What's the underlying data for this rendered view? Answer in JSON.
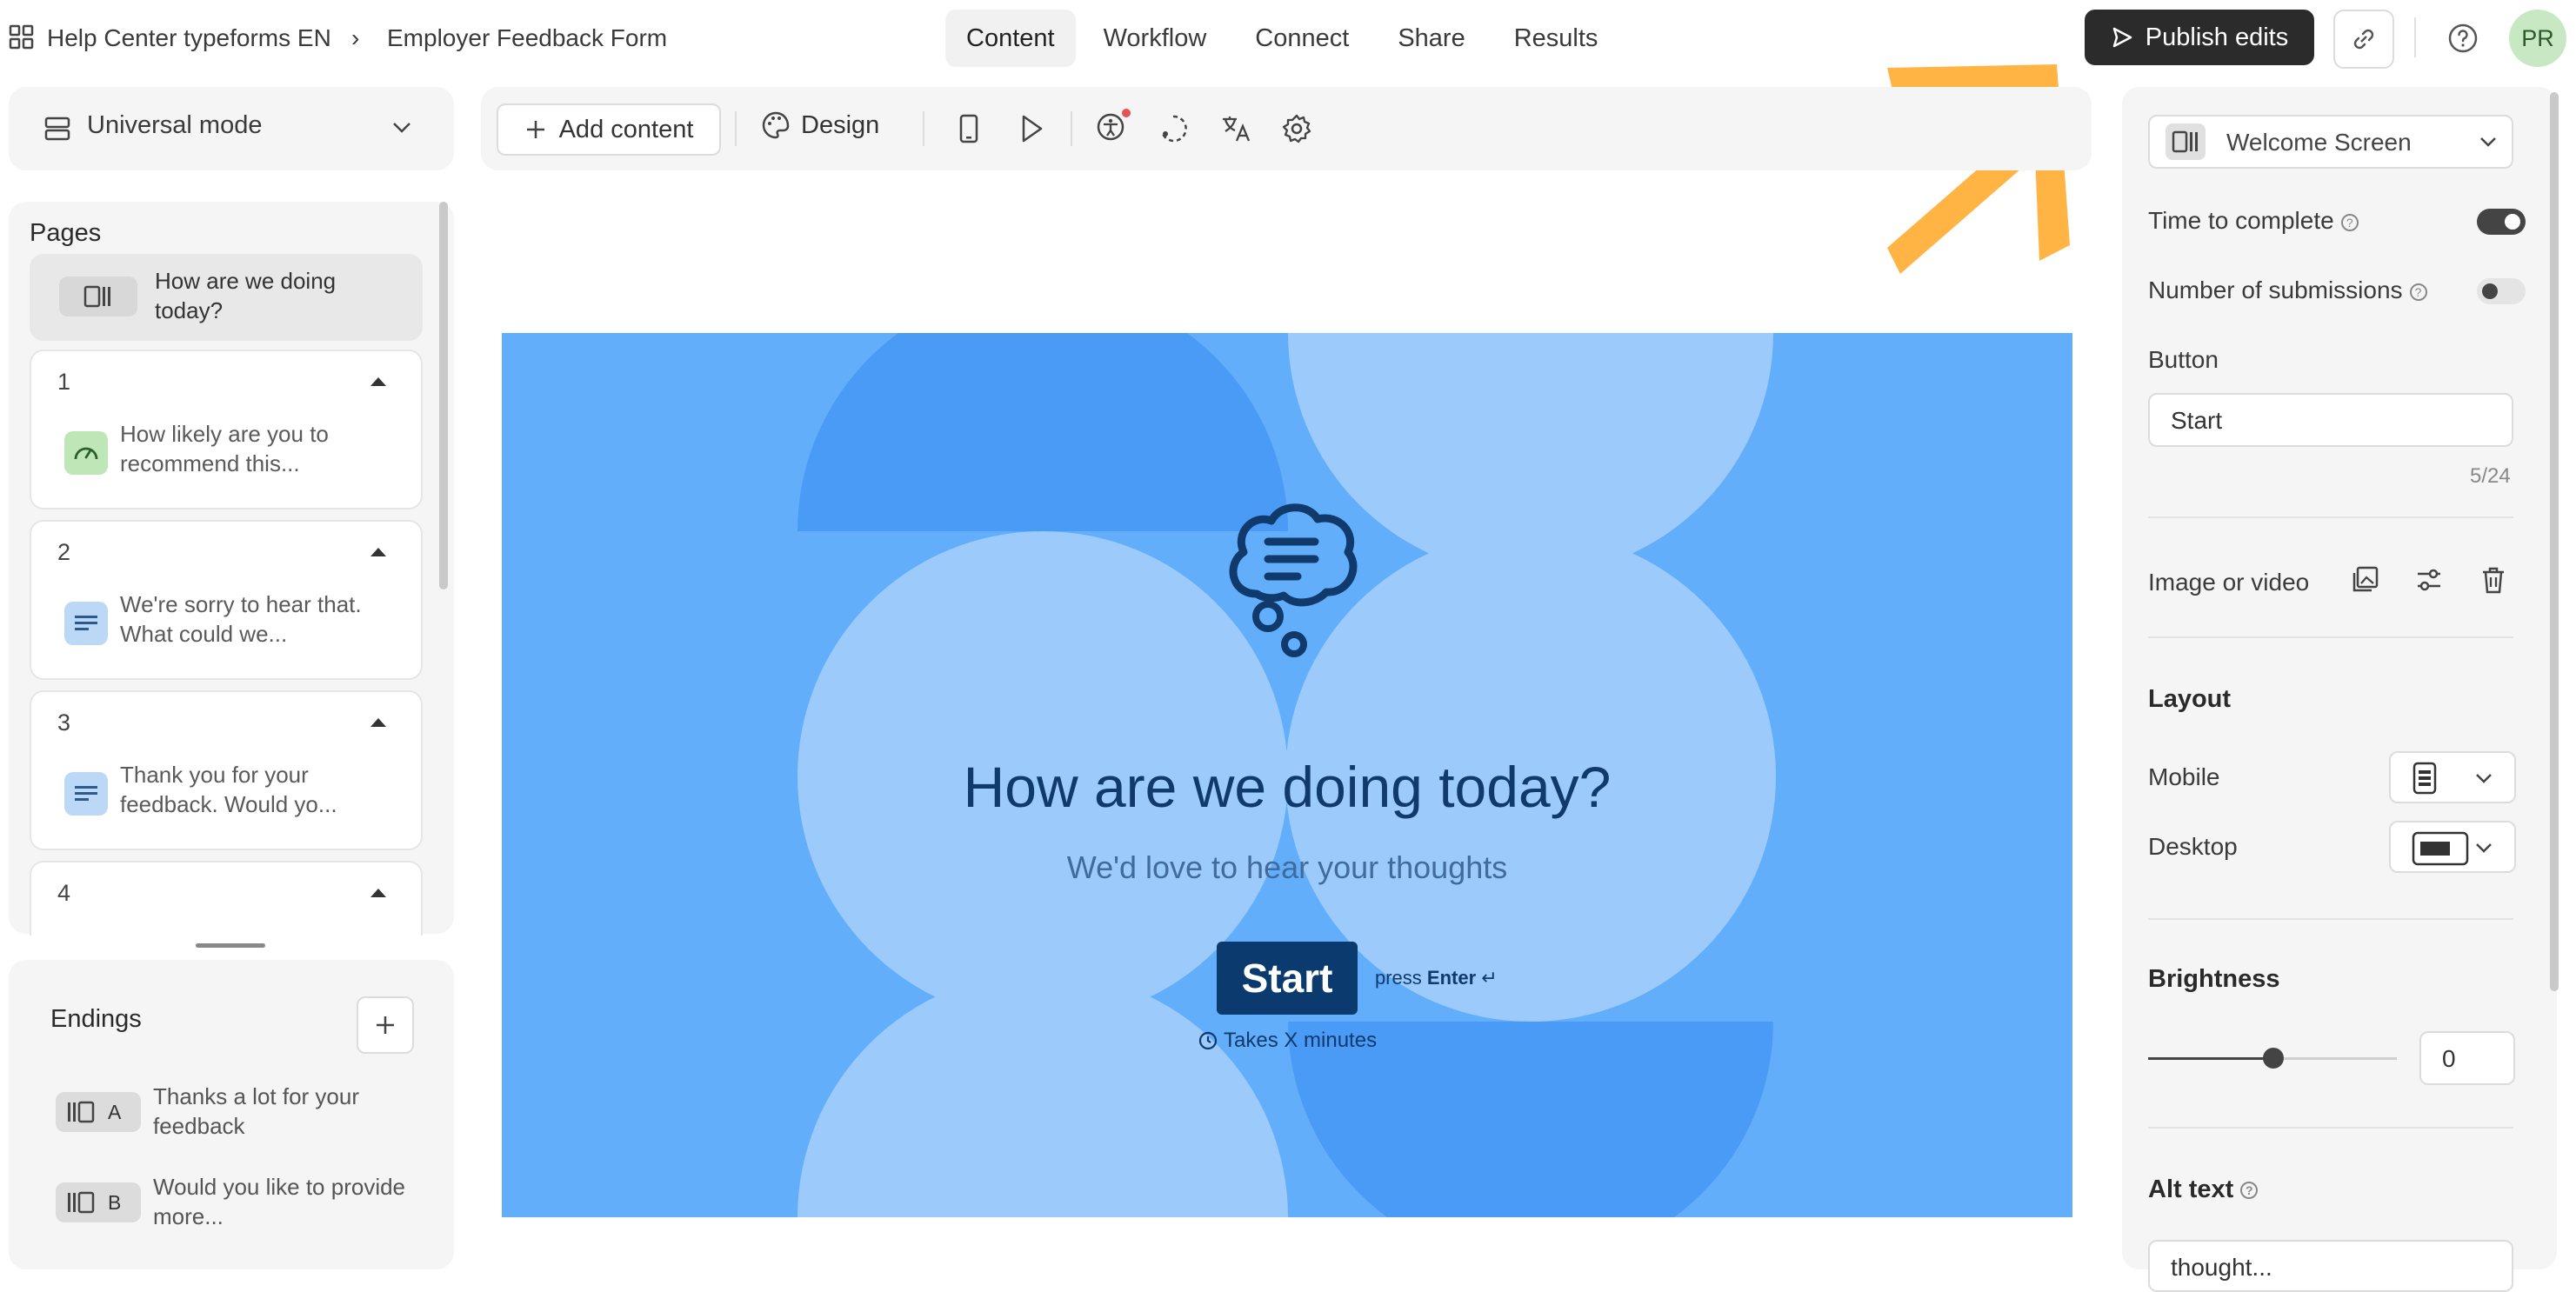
{
  "header": {
    "workspace": "Help Center typeforms EN",
    "separator": "›",
    "form_name": "Employer Feedback Form",
    "tabs": [
      "Content",
      "Workflow",
      "Connect",
      "Share",
      "Results"
    ],
    "active_tab": "Content",
    "publish_label": "Publish edits",
    "avatar_initials": "PR"
  },
  "left": {
    "mode_label": "Universal mode",
    "pages_title": "Pages",
    "welcome_page": "How are we doing today?",
    "pages": [
      {
        "num": "1",
        "text": "How likely are you to recommend this..."
      },
      {
        "num": "2",
        "text": "We're sorry to hear that. What could we..."
      },
      {
        "num": "3",
        "text": "Thank you for your feedback. Would yo..."
      },
      {
        "num": "4",
        "text": ""
      }
    ],
    "endings_title": "Endings",
    "endings": [
      {
        "letter": "A",
        "text": "Thanks a lot for your feedback"
      },
      {
        "letter": "B",
        "text": "Would you like to provide more..."
      }
    ]
  },
  "toolbar": {
    "add_content": "Add content",
    "design": "Design"
  },
  "canvas": {
    "title": "How are we doing today?",
    "subtitle": "We'd love to hear your thoughts",
    "start": "Start",
    "press": "press",
    "enter": "Enter",
    "enter_glyph": "↵",
    "takes": "Takes X minutes",
    "bg_color": "#63aefa"
  },
  "right": {
    "screen_select": "Welcome Screen",
    "time_to_complete": "Time to complete",
    "number_of_submissions": "Number of submissions",
    "button_label": "Button",
    "button_value": "Start",
    "char_count": "5/24",
    "image_or_video": "Image or video",
    "layout": "Layout",
    "mobile": "Mobile",
    "desktop": "Desktop",
    "brightness": "Brightness",
    "brightness_value": "0",
    "alt_text": "Alt text",
    "alt_text_value": "thought..."
  },
  "toggles": {
    "time_to_complete": true,
    "number_of_submissions": false
  },
  "colors": {
    "accent_arrow": "#ffb444",
    "publish_bg": "#2b2b2b",
    "start_button": "#0b3b6e"
  }
}
